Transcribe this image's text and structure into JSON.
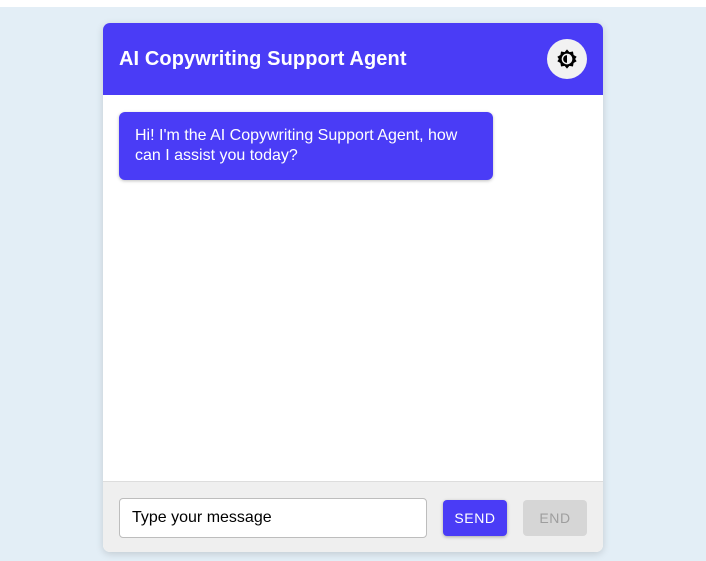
{
  "header": {
    "title": "AI Copywriting Support Agent",
    "theme_toggle_icon": "brightness-icon"
  },
  "messages": [
    {
      "sender": "agent",
      "text": "Hi! I'm the AI Copywriting Support Agent, how can I assist you today?"
    }
  ],
  "composer": {
    "placeholder": "Type your message",
    "value": "",
    "send_label": "SEND",
    "end_label": "END",
    "end_disabled": true
  },
  "colors": {
    "accent": "#4a3cf6",
    "page_background": "#e3eef6",
    "input_bar_background": "#efefef",
    "disabled_button": "#d6d6d6"
  }
}
